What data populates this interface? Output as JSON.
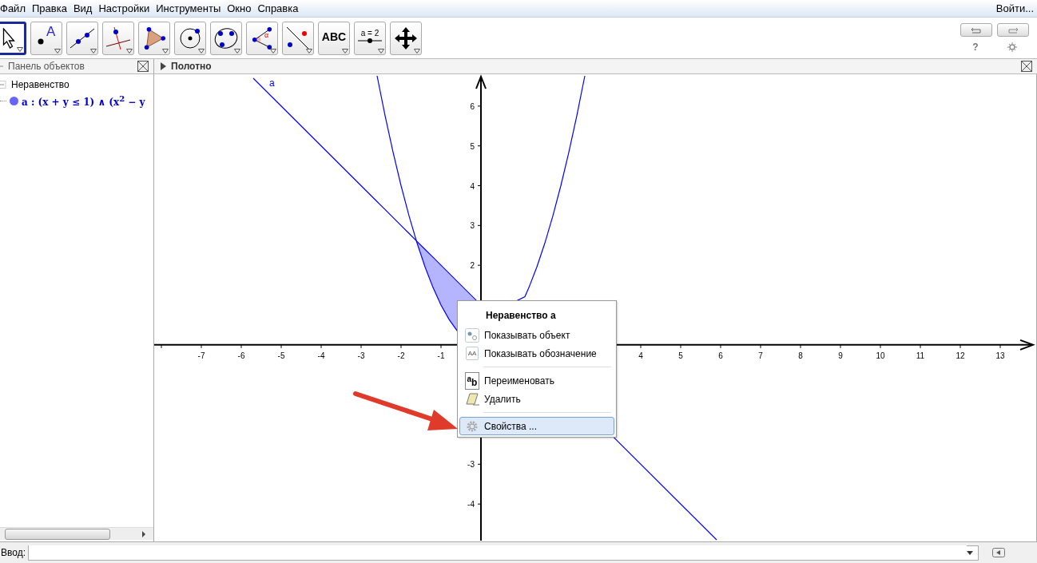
{
  "menubar": [
    "Файл",
    "Правка",
    "Вид",
    "Настройки",
    "Инструменты",
    "Окно",
    "Справка"
  ],
  "login": "Войти...",
  "tools": [
    {
      "kind": "move",
      "selected": true
    },
    {
      "kind": "point",
      "label": "A",
      "selected": false
    },
    {
      "kind": "line",
      "selected": false
    },
    {
      "kind": "perpendicular",
      "selected": false
    },
    {
      "kind": "polygon",
      "selected": false
    },
    {
      "kind": "circle",
      "selected": false
    },
    {
      "kind": "conic",
      "selected": false
    },
    {
      "kind": "angle",
      "label": "α",
      "selected": false
    },
    {
      "kind": "reflect",
      "selected": false
    },
    {
      "kind": "text",
      "label": "ABC",
      "selected": false
    },
    {
      "kind": "slider",
      "label": "a = 2",
      "selected": false
    },
    {
      "kind": "pan",
      "selected": false
    }
  ],
  "help": "?",
  "algebra": {
    "title": "Панель объектов",
    "group": "Неравенство",
    "objects": [
      {
        "text": "a : (x + y ≤ 1) ∧ (x$^{2}$ − y",
        "color": "#6666ff"
      }
    ]
  },
  "graphics": {
    "title": "Полотно",
    "chart_data": {
      "type": "line",
      "xlim": [
        -8.18,
        13.9
      ],
      "ylim": [
        -4.92,
        6.8
      ],
      "x": [
        -5.7,
        -2.6,
        -2.4,
        -2.2,
        -2,
        -1.8,
        -1.6,
        -1.4,
        -1.2,
        -1,
        -0.8,
        -0.6,
        1.1,
        1.2,
        1.4,
        1.6,
        1.8,
        2,
        2.2,
        2.4,
        2.6,
        3.4,
        5.9
      ],
      "series": [
        {
          "name": "a",
          "color": "#0000ff",
          "values": [
            6.7,
            3.6,
            3.4,
            3.2,
            3,
            2.8,
            2.6,
            2.4,
            2.2,
            2,
            1.8,
            1.6,
            null,
            null,
            null,
            null,
            null,
            null,
            null,
            null,
            null,
            -2.4,
            -4.9
          ]
        },
        {
          "color": "#0000ff",
          "values": [
            null,
            6.76,
            5.76,
            4.84,
            4,
            3.24,
            2.56,
            1.96,
            1.44,
            1,
            0.64,
            0.36,
            1.21,
            1.44,
            1.96,
            2.56,
            3.24,
            4,
            4.84,
            5.76,
            6.76,
            null,
            null
          ]
        }
      ],
      "xticks": [
        -7,
        -6,
        -5,
        -4,
        -3,
        -2,
        -1,
        4,
        5,
        6,
        7,
        8,
        9,
        10,
        11,
        12,
        13
      ],
      "yticks": [
        -4,
        -3,
        2,
        3,
        4,
        5,
        6
      ]
    }
  },
  "context_menu": [
    {
      "kind": "header",
      "text": "Неравенство a"
    },
    {
      "kind": "show",
      "text": "Показывать объект",
      "selected": false
    },
    {
      "kind": "label",
      "text": "Показывать обозначение",
      "icon_text": "AA",
      "selected": false
    },
    {
      "kind": "separator"
    },
    {
      "kind": "rename",
      "text": "Переименовать",
      "icon_text": "$^{a}$b",
      "selected": false
    },
    {
      "kind": "delete",
      "text": "Удалить",
      "selected": false
    },
    {
      "kind": "separator"
    },
    {
      "kind": "properties",
      "text": "Свойства ...",
      "selected": true
    }
  ],
  "input": {
    "label": "Ввод:"
  }
}
